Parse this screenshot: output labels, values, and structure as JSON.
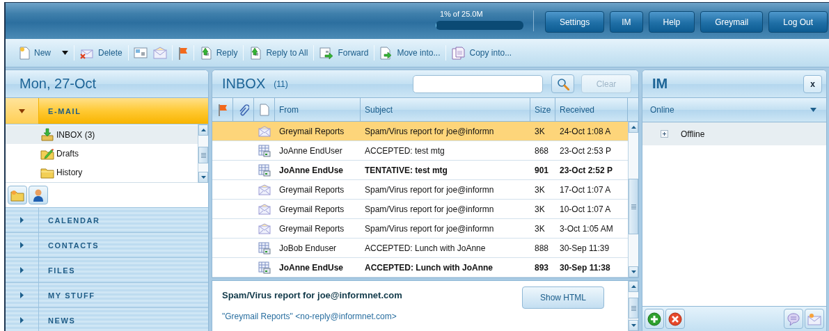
{
  "header": {
    "storage": {
      "label": "1% of 25.0M",
      "level": 0.01
    },
    "buttons": [
      "Settings",
      "IM",
      "Help",
      "Greymail",
      "Log Out"
    ]
  },
  "toolbar": [
    {
      "label": "New",
      "kind": "menu"
    },
    {
      "label": "Delete",
      "kind": "button"
    },
    {
      "label": "Reply",
      "kind": "button"
    },
    {
      "label": "Reply to All",
      "kind": "button"
    },
    {
      "label": "Forward",
      "kind": "button"
    },
    {
      "label": "Move into...",
      "kind": "button"
    },
    {
      "label": "Copy into...",
      "kind": "button"
    }
  ],
  "sidebar": {
    "date": "Mon, 27-Oct",
    "sections": [
      {
        "label": "E-MAIL",
        "expanded": true,
        "folders": [
          {
            "name": "INBOX (3)",
            "kind": "inbox",
            "selected": true
          },
          {
            "name": "Drafts",
            "kind": "drafts",
            "selected": false
          },
          {
            "name": "History",
            "kind": "folder",
            "selected": false
          }
        ]
      },
      {
        "label": "CALENDAR",
        "expanded": false
      },
      {
        "label": "CONTACTS",
        "expanded": false
      },
      {
        "label": "FILES",
        "expanded": false
      },
      {
        "label": "MY STUFF",
        "expanded": false
      },
      {
        "label": "NEWS",
        "expanded": false
      }
    ]
  },
  "inbox": {
    "title": "INBOX",
    "count": "(11)",
    "clear": {
      "label": "Clear",
      "disabled": true
    },
    "columns": [
      "From",
      "Subject",
      "Size",
      "Received"
    ],
    "rows": [
      {
        "kind": "mail",
        "from": "Greymail Reports",
        "subject": "Spam/Virus report for joe@informn",
        "size": "3K",
        "received": "24-Oct 1:08 A",
        "selected": true,
        "unread": false
      },
      {
        "kind": "meeting",
        "from": "JoAnne EndUser",
        "subject": "ACCEPTED: test mtg",
        "size": "868",
        "received": "23-Oct 2:53 P",
        "selected": false,
        "unread": false
      },
      {
        "kind": "meeting",
        "from": "JoAnne EndUse",
        "subject": "TENTATIVE: test mtg",
        "size": "901",
        "received": "23-Oct 2:52 P",
        "selected": false,
        "unread": true
      },
      {
        "kind": "mail",
        "from": "Greymail Reports",
        "subject": "Spam/Virus report for joe@informn",
        "size": "3K",
        "received": "17-Oct 1:07 A",
        "selected": false,
        "unread": false
      },
      {
        "kind": "mail",
        "from": "Greymail Reports",
        "subject": "Spam/Virus report for joe@informn",
        "size": "3K",
        "received": "10-Oct 1:07 A",
        "selected": false,
        "unread": false
      },
      {
        "kind": "mail",
        "from": "Greymail Reports",
        "subject": "Spam/Virus report for joe@informn",
        "size": "3K",
        "received": "3-Oct 1:05 AM",
        "selected": false,
        "unread": false
      },
      {
        "kind": "meeting",
        "from": "JoBob Enduser",
        "subject": "ACCEPTED: Lunch with JoAnne",
        "size": "888",
        "received": "30-Sep 11:39",
        "selected": false,
        "unread": false
      },
      {
        "kind": "meeting",
        "from": "JoAnne EndUse",
        "subject": "ACCEPTED: Lunch with JoAnne",
        "size": "893",
        "received": "30-Sep 11:38",
        "selected": false,
        "unread": true
      }
    ],
    "preview": {
      "subject": "Spam/Virus report for joe@informnet.com",
      "button": "Show HTML",
      "from": "\"Greymail Reports\" <no-reply@informnet.com>"
    }
  },
  "im": {
    "title": "IM",
    "close": "x",
    "status": "Online",
    "groups": [
      {
        "label": "Offline",
        "expanded": false
      }
    ]
  }
}
